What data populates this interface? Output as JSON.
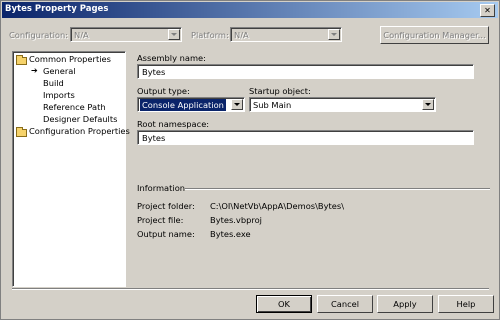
{
  "window": {
    "title": "Bytes Property Pages",
    "close_glyph": "✕"
  },
  "top": {
    "configuration_label": "Configuration:",
    "configuration_value": "N/A",
    "platform_label": "Platform:",
    "platform_value": "N/A",
    "config_manager_label": "Configuration Manager..."
  },
  "tree": {
    "common": "Common Properties",
    "items": [
      "General",
      "Build",
      "Imports",
      "Reference Path",
      "Designer Defaults"
    ],
    "selected_marker": "➔",
    "config": "Configuration Properties"
  },
  "form": {
    "assembly_label": "Assembly name:",
    "assembly_value": "Bytes",
    "output_type_label": "Output type:",
    "output_type_value": "Console Application",
    "startup_label": "Startup object:",
    "startup_value": "Sub Main",
    "root_ns_label": "Root namespace:",
    "root_ns_value": "Bytes"
  },
  "info": {
    "heading": "Information",
    "project_folder_label": "Project folder:",
    "project_folder_value": "C:\\OI\\NetVb\\AppA\\Demos\\Bytes\\",
    "project_file_label": "Project file:",
    "project_file_value": "Bytes.vbproj",
    "output_name_label": "Output name:",
    "output_name_value": "Bytes.exe"
  },
  "buttons": {
    "ok": "OK",
    "cancel": "Cancel",
    "apply": "Apply",
    "help": "Help"
  }
}
